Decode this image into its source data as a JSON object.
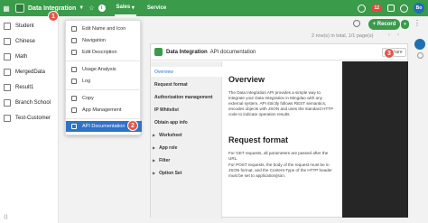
{
  "topbar": {
    "app_title": "Data Integration",
    "tabs": [
      {
        "label": "Sales",
        "active": true
      },
      {
        "label": "Service",
        "active": false
      }
    ],
    "notification_count": "12",
    "avatar_initials": "Bo",
    "bg_color": "#3a9b4a"
  },
  "markers": [
    "1",
    "2",
    "3"
  ],
  "sidebar": {
    "items": [
      {
        "label": "Student"
      },
      {
        "label": "Chinese"
      },
      {
        "label": "Math"
      },
      {
        "label": "MergedData"
      },
      {
        "label": "Result1"
      },
      {
        "label": "Branch School"
      },
      {
        "label": "Test-Customer"
      }
    ]
  },
  "toolbar": {
    "record_label": "+ Record",
    "rows_info": "2 row(s) in total, 1/1 page(s)"
  },
  "app_menu": {
    "items": [
      {
        "label": "Edit Name and Icon",
        "active": false
      },
      {
        "label": "Navigation",
        "active": false
      },
      {
        "label": "Edit Description",
        "active": false
      },
      {
        "label": "Usage Analysis",
        "active": false
      },
      {
        "label": "Log",
        "active": false
      },
      {
        "label": "Copy",
        "active": false
      },
      {
        "label": "App Management",
        "active": false
      },
      {
        "label": "API Documentation",
        "active": true
      }
    ],
    "active_color": "#2e73c8"
  },
  "api_doc": {
    "title_bold": "Data Integration",
    "title_rest": "API documentation",
    "share_label": "Share",
    "nav": [
      {
        "label": "Overview",
        "active": true,
        "expandable": false
      },
      {
        "label": "Request format",
        "active": false,
        "expandable": false
      },
      {
        "label": "Authorization management",
        "active": false,
        "expandable": false
      },
      {
        "label": "IP Whitelist",
        "active": false,
        "expandable": false
      },
      {
        "label": "Obtain app info",
        "active": false,
        "expandable": false
      },
      {
        "label": "Worksheet",
        "active": false,
        "expandable": true
      },
      {
        "label": "App role",
        "active": false,
        "expandable": true
      },
      {
        "label": "Filter",
        "active": false,
        "expandable": true
      },
      {
        "label": "Option Set",
        "active": false,
        "expandable": true
      }
    ],
    "overview_heading": "Overview",
    "overview_text": "The Data Integration API provides a simple way to integrate your Data Integration in Mingdao with any external system. API strictly follows REST semantics, encodes objects with JSON and uses the standard HTTP code to indicate operation results.",
    "request_heading": "Request format",
    "request_text_1": "For GET requests, all parameters are passed after the URL.",
    "request_text_2": "For POST requests, the body of the request must be in JSON format, and the Content-Type of the HTTP header must be set to application/json."
  }
}
